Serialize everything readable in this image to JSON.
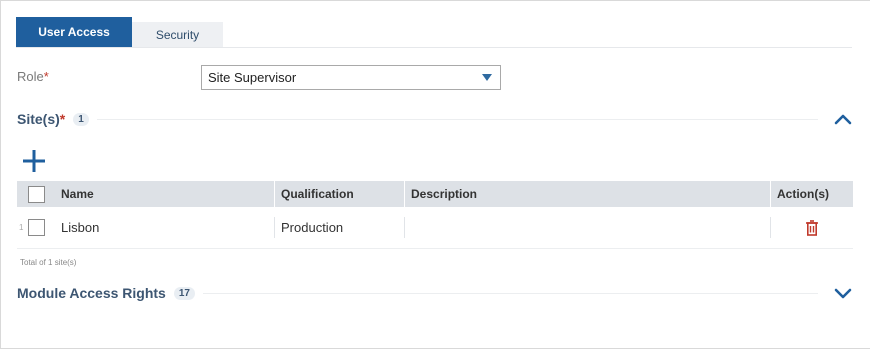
{
  "tabs": [
    {
      "label": "User Access",
      "active": true
    },
    {
      "label": "Security",
      "active": false
    }
  ],
  "role": {
    "label": "Role",
    "required_mark": "*",
    "value": "Site Supervisor"
  },
  "sites": {
    "title": "Site(s)",
    "required_mark": "*",
    "count": "1",
    "expanded": true,
    "columns": [
      "Name",
      "Qualification",
      "Description",
      "Action(s)"
    ],
    "rows": [
      {
        "num": "1",
        "name": "Lisbon",
        "qualification": "Production",
        "description": ""
      }
    ],
    "total_text": "Total of 1 site(s)"
  },
  "module_access": {
    "title": "Module Access Rights",
    "count": "17",
    "expanded": false
  },
  "icons": {
    "add": "plus-icon",
    "delete": "trash-icon",
    "collapse": "chevron-up-icon",
    "expand": "chevron-down-icon",
    "dropdown": "caret-down-icon"
  },
  "colors": {
    "accent": "#1f5f9e",
    "tab_inactive_bg": "#eef0f3",
    "header_bg": "#dde1e6",
    "required": "#c0392b",
    "delete": "#c0392b"
  }
}
